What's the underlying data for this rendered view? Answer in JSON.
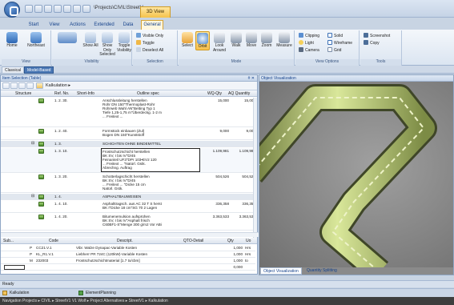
{
  "title_bar": {
    "path": "\\Projects\\CIVIL\\StreetV...",
    "context_tab": "3D View"
  },
  "tabs": [
    "Start",
    "View",
    "Actions",
    "Extended",
    "Data",
    "General"
  ],
  "ribbon": {
    "view_group": {
      "label": "View",
      "home": "Home",
      "northeast": "Northeast"
    },
    "visibility_group": {
      "label": "Visibility",
      "show_all": "Show All",
      "show_only_selected": "Show Only Selected",
      "toggle_visibility": "Toggle Visibility"
    },
    "selection_group": {
      "label": "Selection",
      "visible_only": "Visible Only",
      "toggle": "Toggle",
      "deselect_all": "Deselect All"
    },
    "mode_group": {
      "label": "Mode",
      "select": "Select",
      "orbit": "Orbit",
      "look_around": "Look Around",
      "walk": "Walk",
      "move": "Move",
      "zoom": "Zoom",
      "measure": "Measure"
    },
    "view_options_group": {
      "label": "View Options",
      "clipping": "Clipping",
      "light": "Light",
      "camera": "Camera",
      "solid": "Solid",
      "wireframe": "Wireframe",
      "grid": "Grid"
    },
    "tools_group": {
      "label": "Tools",
      "screenshot": "Screenshot",
      "copy": "Copy"
    }
  },
  "subtabs": [
    "Classical",
    "Model-Based"
  ],
  "item_panel": {
    "title": "Item Selection (Table)",
    "controls": "# ✕",
    "breadcrumb": "Kalkulation ▸",
    "columns": [
      "Structure",
      "Ref. No.",
      "Short-Info",
      "Outline spec",
      "WQ-Qty",
      "AQ Quantity"
    ],
    "rows": [
      {
        "ref": "1. 2. 30.",
        "desc": "Anschlussleitung herstellen\nRohr DN 150\"Thermoplast-Rohr\nRohrweb Wahl AN\"Betting Typ 1\nTiefe 1,25-1,75 m\"Überdeckg. 1-2 m\n... Freitext ...",
        "wq": "15,000",
        "aq": "15,000",
        "group": false
      },
      {
        "ref": "1. 2. 40.",
        "desc": "Formstück einbauen (Zul)\nBogen DN 150\"Kunststoff",
        "wq": "9,000",
        "aq": "9,000",
        "group": false
      },
      {
        "ref": "1. 3.",
        "desc": "SCHICHTEN OHNE BINDEMITTEL",
        "wq": "",
        "aq": "",
        "group": true
      },
      {
        "ref": "1. 3. 10.",
        "desc": "Frostschutzschicht herstellen\nBK SV, I bis IV\"D/45\nFeinanteil UF3\"DPr 103•EV2 120\n... Freitext ... \"Natürl. Gstk.\nAbrechng. Auftrag",
        "wq": "1.109,981",
        "aq": "1.109,981",
        "group": false
      },
      {
        "ref": "1. 3. 20.",
        "desc": "Schotterlagschicht herstellen\nBK SV, I bis IV\"D/45\n... Freitext ... \"Dicke 15 cm\nNatürl. Gstk.",
        "wq": "504,526",
        "aq": "504,526",
        "group": false
      },
      {
        "ref": "1. 4.",
        "desc": "ASPHALTBAUWEISEN",
        "wq": "",
        "aq": "",
        "group": true
      },
      {
        "ref": "1. 4. 10.",
        "desc": "Asphalttragsch. aus AC 32 T S herst\nBK I\"Dicke 18 cm\"SG 70 2 Lagen",
        "wq": "336,358",
        "aq": "336,358",
        "group": false
      },
      {
        "ref": "1. 4. 20.",
        "desc": "Bitumenemulsion aufsprühen\nBK SV, I bis IV\"Asphalt frisch\nC60BF1-S\"Menge 300 g/m2 Vor ABi",
        "wq": "3.363,533",
        "aq": "3.363,533",
        "group": false
      }
    ]
  },
  "sub_table": {
    "columns": [
      "Sub...",
      "Code",
      "Descript.",
      "QTO-Detail",
      "Qty",
      "Uo"
    ],
    "rows": [
      {
        "sub": "P",
        "code": "CC21.V.1",
        "desc": "Vibr. Walze Dynapac-Variable Kosten",
        "qty": "1,000",
        "uo": "Hrs"
      },
      {
        "sub": "P",
        "code": "KL_R1.V.1",
        "desc": "Liebherr PR 724C (120kW)-Variable Kosten",
        "qty": "1,000",
        "uo": "Hrs"
      },
      {
        "sub": "M",
        "code": "232003",
        "desc": "Frostschutzschichtmaterial [1.7 to/cbm]",
        "qty": "1,000",
        "uo": "to"
      },
      {
        "sub": "",
        "code": "",
        "desc": "",
        "qty": "0,000",
        "uo": ""
      }
    ]
  },
  "viz_panel": {
    "title": "Object Visualization",
    "tabs": [
      "Object Visualization",
      "Quantity Splitting"
    ]
  },
  "status": "Ready",
  "taskbar": {
    "item1": "Kalkulation",
    "item2": "ElementPlanning"
  },
  "navbar": "Navigation   Projects ▸ CIVIL ▸ StreetV1 V1 Wolf ▸ Project Alternatives ▸ StreetV1 ▸ Kalkulation",
  "colors": {
    "accent": "#f7c14e",
    "ribbon_text": "#15428b",
    "road_green": "#bcd77a"
  }
}
